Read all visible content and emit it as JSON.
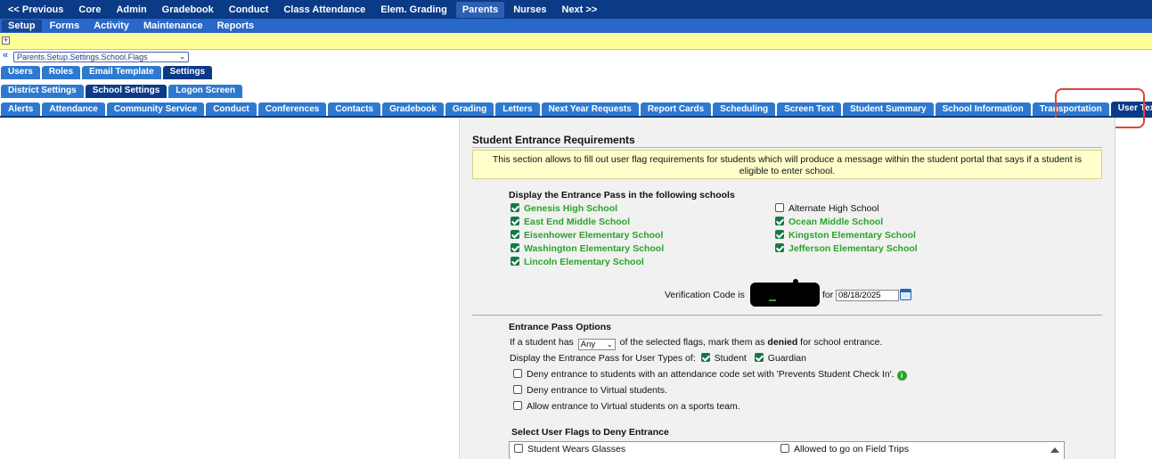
{
  "topnav": {
    "items": [
      "<< Previous",
      "Core",
      "Admin",
      "Gradebook",
      "Conduct",
      "Class Attendance",
      "Elem. Grading",
      "Parents",
      "Nurses",
      "Next >>"
    ],
    "active": "Parents"
  },
  "subnav": {
    "items": [
      "Setup",
      "Forms",
      "Activity",
      "Maintenance",
      "Reports"
    ],
    "active": "Setup"
  },
  "expander": "+",
  "path": {
    "arrow": "«",
    "value": "Parents.Setup.Settings.School.Flags",
    "chevron": "⌄"
  },
  "tabs_row1": [
    "Users",
    "Roles",
    "Email Template",
    "Settings"
  ],
  "tabs_row2": [
    "District Settings",
    "School Settings",
    "Logon Screen"
  ],
  "tabs_row3": [
    "Alerts",
    "Attendance",
    "Community Service",
    "Conduct",
    "Conferences",
    "Contacts",
    "Gradebook",
    "Grading",
    "Letters",
    "Next Year Requests",
    "Report Cards",
    "Scheduling",
    "Screen Text",
    "Student Summary",
    "School Information",
    "Transportation",
    "User Text/Flags"
  ],
  "panel": {
    "title": "Student Entrance Requirements",
    "info_line1": "This section allows to fill out user flag requirements for students which will produce a message within the student portal that says if a student is",
    "info_line2": "eligible to enter school.",
    "schools_heading": "Display the Entrance Pass in the following schools",
    "schools_left": [
      {
        "name": "Genesis High School",
        "checked": true
      },
      {
        "name": "East End Middle School",
        "checked": true
      },
      {
        "name": "Eisenhower Elementary School",
        "checked": true
      },
      {
        "name": "Washington Elementary School",
        "checked": true
      },
      {
        "name": "Lincoln Elementary School",
        "checked": true
      }
    ],
    "schools_right": [
      {
        "name": "Alternate High School",
        "checked": false
      },
      {
        "name": "Ocean Middle School",
        "checked": true
      },
      {
        "name": "Kingston Elementary School",
        "checked": true
      },
      {
        "name": "Jefferson Elementary School",
        "checked": true
      }
    ],
    "verification_label": "Verification Code is",
    "for_label": "for",
    "date": "08/18/2025",
    "options_heading": "Entrance Pass Options",
    "if_prefix": "If a student has",
    "any_value": "Any",
    "if_suffix": "of the selected flags, mark them as",
    "denied": "denied",
    "if_end": "for school entrance.",
    "display_for": "Display the Entrance Pass for User Types of:",
    "student": "Student",
    "guardian": "Guardian",
    "deny_attendance": "Deny entrance to students with an attendance code set with 'Prevents Student Check In'.",
    "deny_virtual": "Deny entrance to Virtual students.",
    "allow_virtual": "Allow entrance to Virtual students on a sports team.",
    "flags_heading": "Select User Flags to Deny Entrance",
    "flag_left": "Student Wears Glasses",
    "flag_right": "Allowed to go on Field Trips",
    "info_icon": "i"
  }
}
